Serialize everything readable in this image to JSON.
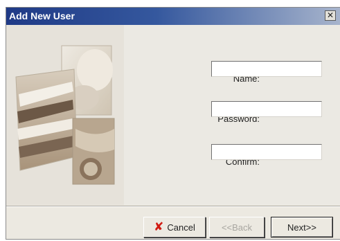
{
  "window": {
    "title": "Add New User",
    "close_glyph": "✕"
  },
  "form": {
    "fields": [
      {
        "label": "Name:",
        "value": ""
      },
      {
        "label": "Password:",
        "value": ""
      },
      {
        "label": "Confirm:",
        "value": ""
      }
    ]
  },
  "buttons": {
    "cancel": {
      "label": "Cancel",
      "icon": "red-x-icon"
    },
    "back": {
      "label": "<<Back",
      "enabled": false
    },
    "next": {
      "label": "Next>>",
      "enabled": true
    }
  },
  "colors": {
    "title_bar_start": "#1f3a86",
    "title_bar_end": "#a7b4cc",
    "dialog_face": "#ece9e1",
    "cancel_icon": "#d11a12"
  }
}
